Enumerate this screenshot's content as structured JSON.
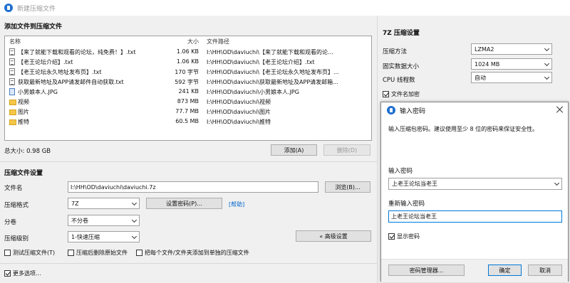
{
  "window": {
    "title": "新建压缩文件"
  },
  "files_section": {
    "title": "添加文件到压缩文件",
    "columns": {
      "name": "名称",
      "size": "大小",
      "path": "文件路径"
    },
    "rows": [
      {
        "icon": "txt",
        "name": "【来了就能下载和观看的论坛，纯免费！】.txt",
        "size": "1.06 KB",
        "path": "I:\\HH\\OD\\daviuchi\\【来了就能下载和观看的论..."
      },
      {
        "icon": "txt",
        "name": "【老王论坛介绍】.txt",
        "size": "1.06 KB",
        "path": "I:\\HH\\OD\\daviuchi\\【老王论坛介绍】.txt"
      },
      {
        "icon": "txt",
        "name": "【老王论坛永久地址发布页】.txt",
        "size": "170 字节",
        "path": "I:\\HH\\OD\\daviuchi\\【老王论坛永久地址发布页】..."
      },
      {
        "icon": "txt",
        "name": "获取最新地址及APP请发邮件自动获取.txt",
        "size": "592 字节",
        "path": "I:\\HH\\OD\\daviuchi\\获取最新地址及APP请发邮箱..."
      },
      {
        "icon": "img",
        "name": "小男娘本人.JPG",
        "size": "241 KB",
        "path": "I:\\HH\\OD\\daviuchi\\小男娘本人.JPG"
      },
      {
        "icon": "folder",
        "name": "视频",
        "size": "873 MB",
        "path": "I:\\HH\\OD\\daviuchi\\视频"
      },
      {
        "icon": "folder",
        "name": "图片",
        "size": "77.7 MB",
        "path": "I:\\HH\\OD\\daviuchi\\图片"
      },
      {
        "icon": "folder",
        "name": "推特",
        "size": "60.5 MB",
        "path": "I:\\HH\\OD\\daviuchi\\推特"
      }
    ],
    "total_size": "总大小: 0.98 GB",
    "add_label": "添加(A)",
    "delete_label": "删除(D)"
  },
  "settings": {
    "title": "压缩文件设置",
    "filename_label": "文件名",
    "filename_value": "I:\\HH\\OD\\daviuchi\\daviuchi.7z",
    "browse_label": "浏览(B)...",
    "format_label": "压缩格式",
    "format_value": "7Z",
    "set_password_label": "设置密码(P)...",
    "help_label": "[帮助]",
    "split_label": "分卷",
    "split_value": "不分卷",
    "level_label": "压缩级别",
    "level_value": "1-快速压缩",
    "advanced_label": "« 高级设置",
    "test_label": "测试压缩文件(T)",
    "delete_after_label": "压缩后删除原始文件",
    "each_separate_label": "把每个文件/文件夹添加到单独的压缩文件",
    "more_options_label": "更多选项..."
  },
  "right_panel": {
    "title": "7Z 压缩设置",
    "method_label": "压缩方法",
    "method_value": "LZMA2",
    "dict_label": "固实数据大小",
    "dict_value": "1024 MB",
    "threads_label": "CPU 线程数",
    "threads_value": "自动",
    "encrypt_names_label": "文件名加密"
  },
  "password_dialog": {
    "title": "输入密码",
    "instruction": "输入压缩包密码。建议使用至少 8 位的密码来保证安全性。",
    "password_label": "输入密码",
    "password_value": "上老王论坛当老王",
    "confirm_label": "重新输入密码",
    "confirm_value": "上老王论坛当老王",
    "show_password_label": "显示密码",
    "manager_label": "密码管理器...",
    "ok_label": "确定",
    "cancel_label": "取消"
  },
  "colors": {
    "accent": "#0078d7",
    "link": "#0066cc",
    "folder": "#f4c64a"
  }
}
